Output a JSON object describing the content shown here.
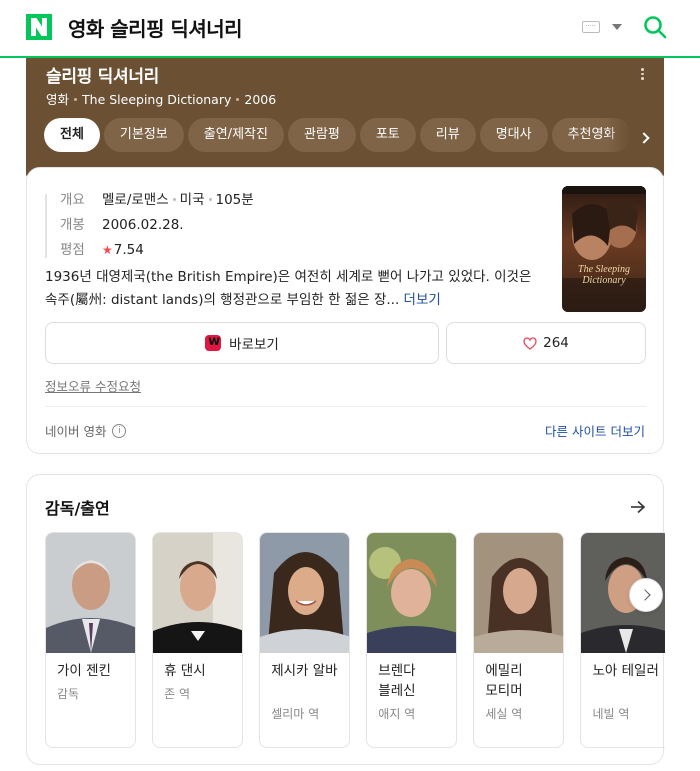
{
  "search": {
    "query": "영화 슬리핑 딕셔너리"
  },
  "movie": {
    "title": "슬리핑 딕셔너리",
    "meta": [
      "영화",
      "The Sleeping Dictionary",
      "2006"
    ]
  },
  "tabs": [
    "전체",
    "기본정보",
    "출연/제작진",
    "관람평",
    "포토",
    "리뷰",
    "명대사",
    "추천영화"
  ],
  "info": {
    "summary_label": "개요",
    "summary_values": [
      "멜로/로맨스",
      "미국",
      "105분"
    ],
    "release_label": "개봉",
    "release_value": "2006.02.28.",
    "rating_label": "평점",
    "rating_star": "★",
    "rating_value": "7.54",
    "description": "1936년 대영제국(the British Empire)은 여전히 세계로 뻗어 나가고 있었다. 이것은 속주(屬州: distant lands)의 행정관으로 부임한 한 젊은 장...",
    "more_label": "더보기",
    "poster_title": "The Sleeping Dictionary",
    "watch_label": "바로보기",
    "like_count": "264",
    "report_label": "정보오류 수정요청",
    "source_label": "네이버 영화",
    "other_sites_label": "다른 사이트 더보기"
  },
  "cast": {
    "title": "감독/출연",
    "people": [
      {
        "name": "가이 젠킨",
        "role": "감독"
      },
      {
        "name": "휴 댄시",
        "role": "존 역"
      },
      {
        "name": "제시카 알바",
        "role": "셀리마 역"
      },
      {
        "name": "브렌다 블레신",
        "role": "애지 역"
      },
      {
        "name": "에밀리 모티머",
        "role": "세실 역"
      },
      {
        "name": "노아 테일러",
        "role": "네빌 역"
      }
    ]
  },
  "colors": {
    "naver_green": "#03c75a",
    "hero_brown": "#6b5034",
    "link_blue": "#1f4ea4",
    "star_red": "#f14b4b"
  }
}
